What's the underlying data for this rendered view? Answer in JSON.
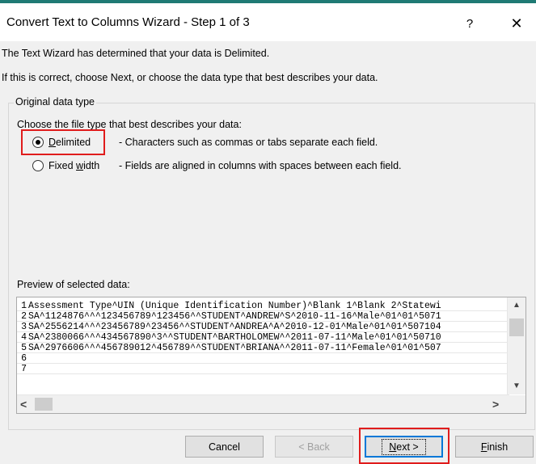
{
  "window": {
    "title": "Convert Text to Columns Wizard - Step 1 of 3",
    "help_label": "?",
    "close_label": "✕"
  },
  "intro": {
    "line1": "The Text Wizard has determined that your data is Delimited.",
    "line2": "If this is correct, choose Next, or choose the data type that best describes your data."
  },
  "original_data_type": {
    "group_label": "Original data type",
    "prompt": "Choose the file type that best describes your data:",
    "options": [
      {
        "accel": "D",
        "rest": "elimited",
        "description": "- Characters such as commas or tabs separate each field.",
        "selected": true
      },
      {
        "pre": "Fixed ",
        "accel": "w",
        "rest": "idth",
        "description": "- Fields are aligned in columns with spaces between each field.",
        "selected": false
      }
    ]
  },
  "preview": {
    "label": "Preview of selected data:",
    "lines": [
      {
        "num": "1",
        "text": "Assessment Type^UIN (Unique Identification Number)^Blank 1^Blank 2^Statewi"
      },
      {
        "num": "2",
        "text": "SA^1124876^^^123456789^123456^^STUDENT^ANDREW^S^2010-11-16^Male^01^01^5071"
      },
      {
        "num": "3",
        "text": "SA^2556214^^^23456789^23456^^STUDENT^ANDREA^A^2010-12-01^Male^01^01^507104"
      },
      {
        "num": "4",
        "text": "SA^2380066^^^434567890^3^^STUDENT^BARTHOLOMEW^^2011-07-11^Male^01^01^50710"
      },
      {
        "num": "5",
        "text": "SA^2976606^^^456789012^456789^^STUDENT^BRIANA^^2011-07-11^Female^01^01^507"
      },
      {
        "num": "6",
        "text": ""
      },
      {
        "num": "7",
        "text": ""
      }
    ]
  },
  "buttons": {
    "cancel": "Cancel",
    "back": "< Back",
    "next_accel": "N",
    "next_rest": "ext >",
    "finish_accel": "F",
    "finish_rest": "inish"
  },
  "colors": {
    "highlight": "#e01c1c",
    "accent_top": "#1f7a74",
    "default_button_border": "#0078d7"
  }
}
